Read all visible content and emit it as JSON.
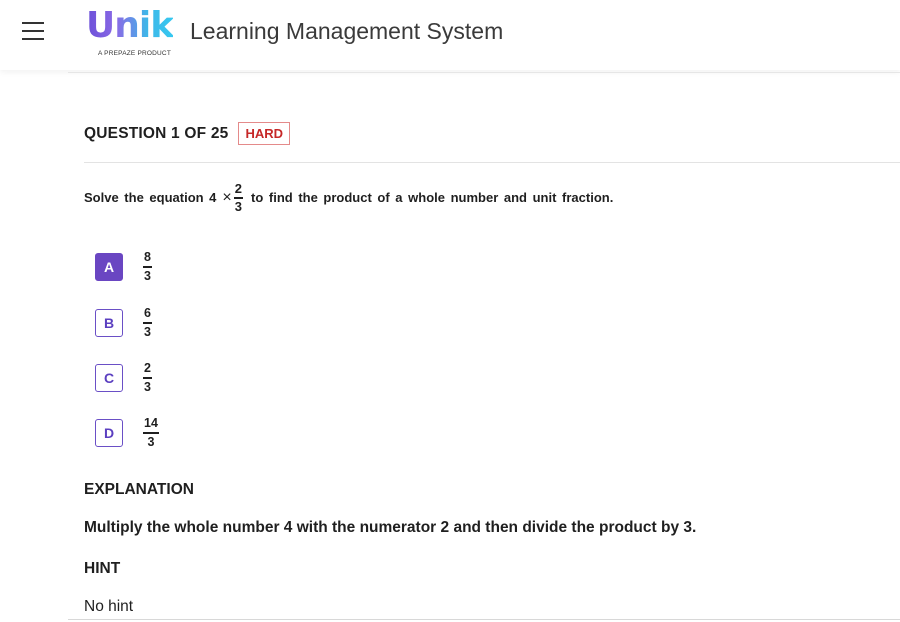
{
  "app": {
    "title": "Learning Management System",
    "logo_text": "Unik",
    "logo_tagline": "A PREPAZE PRODUCT"
  },
  "question": {
    "counter": "QUESTION 1 OF 25",
    "difficulty": "HARD",
    "text_before": "Solve the equation 4",
    "operator": "×",
    "fraction": {
      "numerator": "2",
      "denominator": "3"
    },
    "text_after": "to find the product of a whole number and unit fraction."
  },
  "options": [
    {
      "letter": "A",
      "numerator": "8",
      "denominator": "3",
      "selected": true
    },
    {
      "letter": "B",
      "numerator": "6",
      "denominator": "3",
      "selected": false
    },
    {
      "letter": "C",
      "numerator": "2",
      "denominator": "3",
      "selected": false
    },
    {
      "letter": "D",
      "numerator": "14",
      "denominator": "3",
      "selected": false
    }
  ],
  "explanation": {
    "heading": "EXPLANATION",
    "text": "Multiply the whole number 4 with the numerator 2 and then divide the product by 3."
  },
  "hint": {
    "heading": "HINT",
    "text": "No hint"
  },
  "colors": {
    "accent": "#6a46c2",
    "hard_badge": "#c62828"
  }
}
